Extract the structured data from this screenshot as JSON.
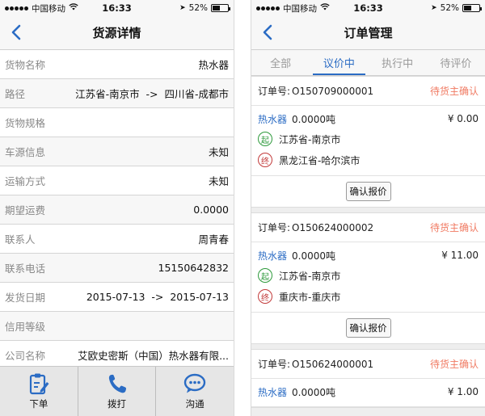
{
  "colors": {
    "accent": "#2b6cc4",
    "pending": "#f07a62",
    "start": "#2e9a3c",
    "end": "#c23a3a"
  },
  "status_bar": {
    "carrier": "中国移动",
    "time": "16:33",
    "battery": "52%",
    "battery_level": 0.52
  },
  "left": {
    "title": "货源详情",
    "back_icon": "chevron-left-icon",
    "rows": [
      {
        "label": "货物名称",
        "value": "热水器"
      },
      {
        "label": "路径",
        "value": "江苏省-南京市  ->  四川省-成都市"
      },
      {
        "label": "货物规格",
        "value": ""
      },
      {
        "label": "车源信息",
        "value": "未知"
      },
      {
        "label": "运输方式",
        "value": "未知"
      },
      {
        "label": "期望运费",
        "value": "0.0000"
      },
      {
        "label": "联系人",
        "value": "周青春"
      },
      {
        "label": "联系电话",
        "value": "15150642832"
      },
      {
        "label": "发货日期",
        "value": "2015-07-13  ->  2015-07-13"
      },
      {
        "label": "信用等级",
        "value": ""
      },
      {
        "label": "公司名称",
        "value": "艾欧史密斯（中国）热水器有限..."
      }
    ],
    "toolbar": [
      {
        "label": "下单",
        "icon": "clipboard-edit-icon"
      },
      {
        "label": "拨打",
        "icon": "phone-icon"
      },
      {
        "label": "沟通",
        "icon": "chat-bubble-icon"
      }
    ]
  },
  "right": {
    "title": "订单管理",
    "tabs": [
      "全部",
      "议价中",
      "执行中",
      "待评价"
    ],
    "active_tab": "议价中",
    "order_label": "订单号:",
    "start_badge": "起",
    "end_badge": "终",
    "confirm_label": "确认报价",
    "orders": [
      {
        "order_no": "O150709000001",
        "status": "待货主确认",
        "goods": "热水器",
        "weight": "0.0000吨",
        "price": "¥ 0.00",
        "from": "江苏省-南京市",
        "to": "黑龙江省-哈尔滨市"
      },
      {
        "order_no": "O150624000002",
        "status": "待货主确认",
        "goods": "热水器",
        "weight": "0.0000吨",
        "price": "¥ 11.00",
        "from": "江苏省-南京市",
        "to": "重庆市-重庆市"
      },
      {
        "order_no": "O150624000001",
        "status": "待货主确认",
        "goods": "热水器",
        "weight": "0.0000吨",
        "price": "¥ 1.00",
        "from": "",
        "to": ""
      }
    ]
  }
}
